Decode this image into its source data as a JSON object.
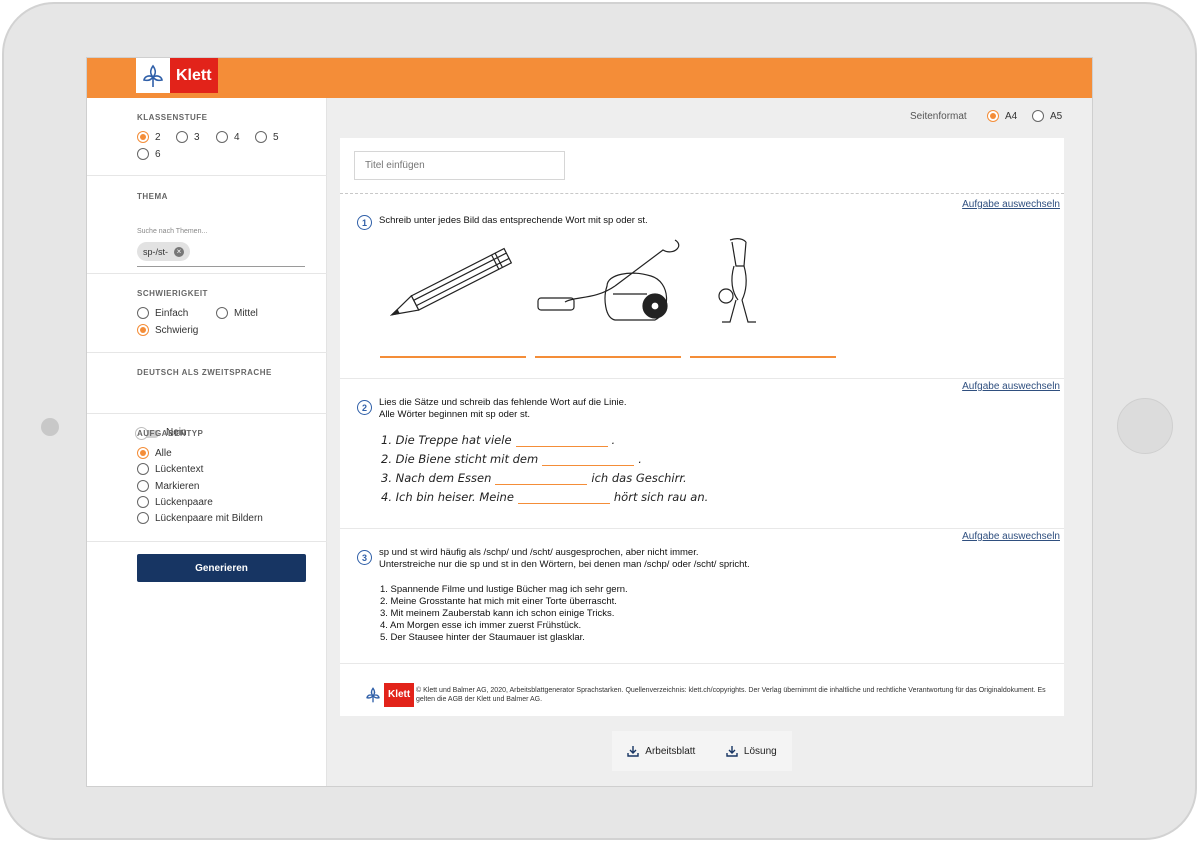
{
  "brand": {
    "name": "Klett",
    "color": "#e2231a",
    "accent": "#f48d38"
  },
  "sidebar": {
    "klassenstufe": {
      "title": "KLASSENSTUFE",
      "options": [
        "2",
        "3",
        "4",
        "5",
        "6"
      ],
      "selected": "2"
    },
    "thema": {
      "title": "THEMA",
      "placeholder": "Suche nach Themen...",
      "chip": "sp-/st-"
    },
    "schwierigkeit": {
      "title": "SCHWIERIGKEIT",
      "options": [
        "Einfach",
        "Mittel",
        "Schwierig"
      ],
      "selected": "Schwierig"
    },
    "daz": {
      "title": "DEUTSCH ALS ZWEITSPRACHE",
      "value": "Nein"
    },
    "aufgabentyp": {
      "title": "AUFGABENTYP",
      "options": [
        "Alle",
        "Lückentext",
        "Markieren",
        "Lückenpaare",
        "Lückenpaare mit Bildern"
      ],
      "selected": "Alle"
    },
    "generate_label": "Generieren"
  },
  "format": {
    "label": "Seitenformat",
    "options": [
      "A4",
      "A5"
    ],
    "selected": "A4"
  },
  "sheet": {
    "title_placeholder": "Titel einfügen",
    "swap_label": "Aufgabe auswechseln",
    "task1": {
      "num": "1",
      "text": "Schreib unter jedes Bild das entsprechende Wort mit sp oder st."
    },
    "task2": {
      "num": "2",
      "line1": "Lies die Sätze und schreib das fehlende Wort auf die Linie.",
      "line2": "Alle Wörter beginnen mit sp oder st.",
      "sentences": [
        {
          "pre": "1.  Die Treppe hat viele",
          "post": "."
        },
        {
          "pre": "2.  Die Biene sticht mit dem",
          "post": "."
        },
        {
          "pre": "3.  Nach dem Essen",
          "post": "ich das Geschirr."
        },
        {
          "pre": "4.  Ich bin heiser. Meine",
          "post": "hört sich rau an."
        }
      ]
    },
    "task3": {
      "num": "3",
      "line1": "sp und st wird häufig als /schp/ und /scht/ ausgesprochen, aber nicht immer.",
      "line2": "Unterstreiche nur die sp und st in den Wörtern, bei denen man /schp/ oder /scht/ spricht.",
      "items": [
        "1.  Spannende Filme und lustige Bücher mag ich sehr gern.",
        "2.  Meine Grosstante hat mich mit einer Torte überrascht.",
        "3.  Mit meinem Zauberstab kann ich schon einige Tricks.",
        "4.  Am Morgen esse ich immer zuerst Frühstück.",
        "5.  Der Stausee hinter der Staumauer ist glasklar."
      ]
    },
    "footer": "© Klett und Balmer AG, 2020, Arbeitsblattgenerator Sprachstarken. Quellenverzeichnis: klett.ch/copyrights. Der Verlag übernimmt die inhaltliche und rechtliche Verantwortung für das Originaldokument. Es gelten die AGB der Klett und Balmer AG."
  },
  "downloads": {
    "worksheet": "Arbeitsblatt",
    "solution": "Lösung"
  }
}
